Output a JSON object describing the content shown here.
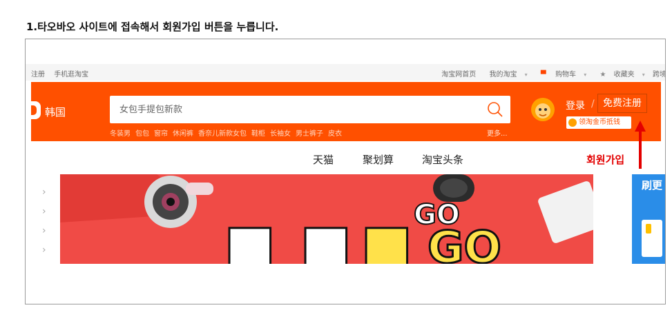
{
  "instruction": {
    "title": "1.타오바오 사이트에 접속해서 회원가입 버튼을 누릅니다."
  },
  "topbar": {
    "left_items": [
      "注册",
      "手机逛淘宝"
    ],
    "right_items": [
      "淘宝网首页",
      "我的淘宝",
      "购物车",
      "收藏夹",
      "跨境"
    ]
  },
  "header": {
    "region": "韩国",
    "search_placeholder": "女包手提包新款",
    "hotwords": [
      "冬装男",
      "包包",
      "窗帘",
      "休闲裤",
      "香奈儿新款女包",
      "鞋柜",
      "长袖女",
      "男士裤子",
      "皮衣"
    ],
    "more_label": "更多...",
    "login_label": "登录",
    "slash": "/",
    "register_label": "免费注册",
    "coupon_label": "领淘金币抵钱",
    "brand_color": "#ff5000"
  },
  "nav": {
    "items": [
      "天猫",
      "聚划算",
      "淘宝头条"
    ]
  },
  "annotation": {
    "label": "회원가입",
    "color": "#e30000"
  },
  "banner": {
    "background": "#f04b46",
    "side_panel_text": "刷更"
  },
  "icons": {
    "search": "search-icon",
    "cart": "cart-icon",
    "star": "star-icon",
    "coin": "coin-icon",
    "avatar": "avatar-mascot"
  }
}
